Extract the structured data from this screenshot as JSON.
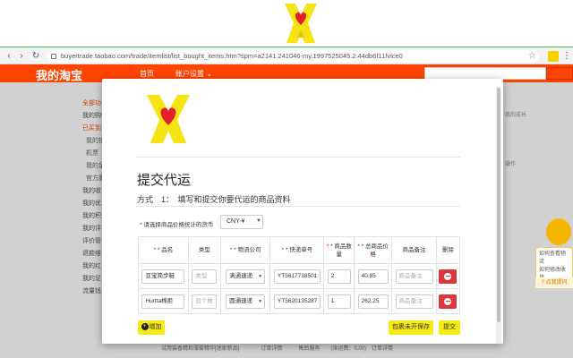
{
  "browser": {
    "url": "buyertrade.taobao.com/trade/itemlist/list_bought_items.htm?spm=a2141.241046-my.1997525045.2.44db6f11fvlce0"
  },
  "taobao": {
    "logo": "我的淘宝",
    "nav_home": "首页",
    "nav_account": "账户设置 ⌄"
  },
  "sidebar": {
    "items": [
      "全部功",
      "我的购物",
      "已买到",
      "我的拍",
      "机票",
      "我的足",
      "官方服",
      "我的收",
      "我的优",
      "我的积",
      "我的评",
      "评价管",
      "退款维",
      "我的红",
      "我的足",
      "流量钱"
    ]
  },
  "helper": {
    "line1": "如何查看物流",
    "line2": "如何修改收货",
    "footer": "? 点我提问"
  },
  "modal": {
    "title": "提交代运",
    "subtitle": "方式　1：　填写和提交你要代运的商品资料",
    "currency_label": "请选择商品价格统计的货币",
    "currency_value": "CNY-¥",
    "table": {
      "headers": [
        "* 品名",
        "类型",
        "* 物流公司",
        "* 快递单号",
        "* 商品数量",
        "* 总商品价格",
        "商品备注",
        "删除"
      ],
      "rows": [
        {
          "name": "亚宝简步鞋",
          "type_placeholder": "类型",
          "carrier": "满通速递",
          "tracking": "YT5617738501",
          "qty": "2",
          "price": "40.85",
          "note_placeholder": "商品备注"
        },
        {
          "name": "Hurtta棉拒",
          "type_placeholder": "显个推",
          "carrier": "圆通速递",
          "tracking": "YT5620135287",
          "qty": "1",
          "price": "262.25",
          "note_placeholder": "商品备注"
        }
      ]
    },
    "add_label": "增加",
    "save_label": "包裹未开保存",
    "submit_label": "提交"
  },
  "background": {
    "right_text1": "我的成长",
    "right_text2": "操作",
    "bottom_text": "试用装香精和薄雾精华[迷家新品]　　　　订单详情　　　售后服务　　(含运费：0.00)　订单详情"
  },
  "colors": {
    "taobao_orange": "#ff4400",
    "accent_yellow": "#f5ea14",
    "delete_red": "#d9363e"
  }
}
